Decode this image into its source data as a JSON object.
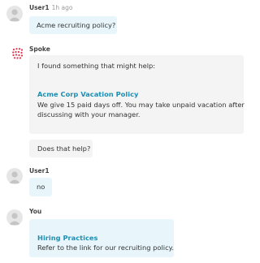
{
  "messages": {
    "m1": {
      "sender": "User1",
      "time": "1h ago",
      "text": "Acme recruiting policy?"
    },
    "m2": {
      "sender": "Spoke",
      "intro": "I found something that might help:",
      "result_title": "Acme Corp Vacation Policy",
      "result_line1": "We give 15 paid days off. You may take unpaid vacation after",
      "result_line2": "discussing with your manager.",
      "followup": "Does that help?"
    },
    "m3": {
      "sender": "User1",
      "text": "no"
    },
    "m4": {
      "sender": "You",
      "result_title": "Hiring Practices",
      "result_text": "Refer to the link for our recruiting policy."
    }
  },
  "colors": {
    "blue_bubble": "#e8f6fb",
    "gray_bubble": "#f4f4f4",
    "link": "#1c8fb3",
    "bot_logo": "#e0334c"
  }
}
